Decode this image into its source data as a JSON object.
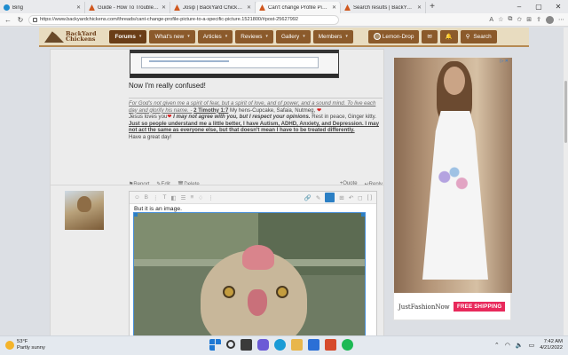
{
  "browser": {
    "tabs": [
      {
        "title": "Bing",
        "icon": "bing",
        "active": false
      },
      {
        "title": "Guide - How To Troubleshoot G",
        "icon": "byc",
        "active": false
      },
      {
        "title": "Josip | BackYard Chickens - Lear",
        "icon": "byc",
        "active": false
      },
      {
        "title": "Can't change Profile Picture to a",
        "icon": "byc",
        "active": true
      },
      {
        "title": "Search results | BackYard Chicke",
        "icon": "byc",
        "active": false
      }
    ],
    "new_tab": "+",
    "url": "https://www.backyardchickens.com/threads/cant-change-profile-picture-to-a-specific-picture.1521800/#post-25627992"
  },
  "site": {
    "logo_line1": "BackYard",
    "logo_line2": "Chickens",
    "nav": [
      {
        "label": "Forums",
        "current": true
      },
      {
        "label": "What's new",
        "current": false
      },
      {
        "label": "Articles",
        "current": false
      },
      {
        "label": "Reviews",
        "current": false
      },
      {
        "label": "Gallery",
        "current": false
      },
      {
        "label": "Members",
        "current": false
      }
    ],
    "username": "Lemon-Drop",
    "search_label": "Search"
  },
  "post1": {
    "text": "Now I'm really confused!",
    "sig_quote": "For God's not given me a spirit of fear, but a spirit of love, and of power, and a sound mind. To live each day and glorify his name. -",
    "sig_ref": "2 Timothy 1:7",
    "sig_pets": " My hens-Cupcake, Safaia, Nutmeg,",
    "sig_jesus": "Jesus loves you",
    "sig_agree": " I may not agree with you, but I respect your opinions.",
    "sig_rip": " Rest in peace, Ginger kitty.",
    "sig_autism": "Just so people understand me a little better, I have Autism, ADHD, Anxiety, and Depression. I may not act the same as everyone else, but that doesn't mean I have to be treated differently.",
    "sig_close": "Have a great day!",
    "actions": {
      "report": "Report",
      "edit": "Edit",
      "delete": "Delete",
      "quote": "Quote",
      "reply": "Reply"
    }
  },
  "editor": {
    "text": "But it is an image."
  },
  "ad": {
    "brand": "JustFashionNow",
    "shipping": "FREE SHIPPING",
    "close": "▷ ✕"
  },
  "taskbar": {
    "temp": "53°F",
    "weather": "Partly sunny",
    "time": "7:42 AM",
    "date": "4/21/2022"
  }
}
